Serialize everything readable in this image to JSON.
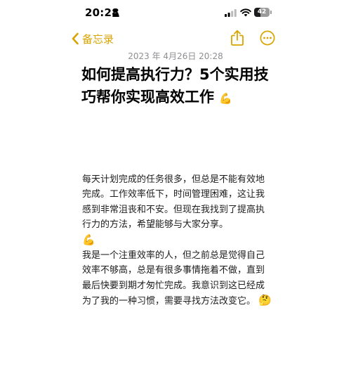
{
  "status_bar": {
    "time": "20:28",
    "battery_level": "42",
    "battery_fraction": 0.42,
    "icons": [
      "person-icon",
      "cellular-signal-icon",
      "wifi-icon",
      "battery-icon"
    ]
  },
  "nav": {
    "back_label": "备忘录",
    "accent_color": "#d9a400",
    "icons": [
      "chevron-left-icon",
      "share-icon",
      "more-options-icon"
    ]
  },
  "note": {
    "date": "2023 年 4月26日 20:28",
    "title": "如何提高执行力？5个实用技巧帮你实现高效工作",
    "title_emoji": "💪",
    "paragraph_1": "每天计划完成的任务很多，但总是不能有效地完成。工作效率低下，时间管理困难，这让我感到非常沮丧和不安。但现在我找到了提高执行力的方法，希望能够与大家分享。",
    "paragraph_1_emoji": "💪",
    "paragraph_2": "我是一个注重效率的人，但之前总是觉得自己效率不够高，总是有很多事情拖着不做，直到最后快要到期才匆忙完成。我意识到这已经成为了我的一种习惯，需要寻找方法改变它。",
    "paragraph_2_emoji": "🤔"
  }
}
